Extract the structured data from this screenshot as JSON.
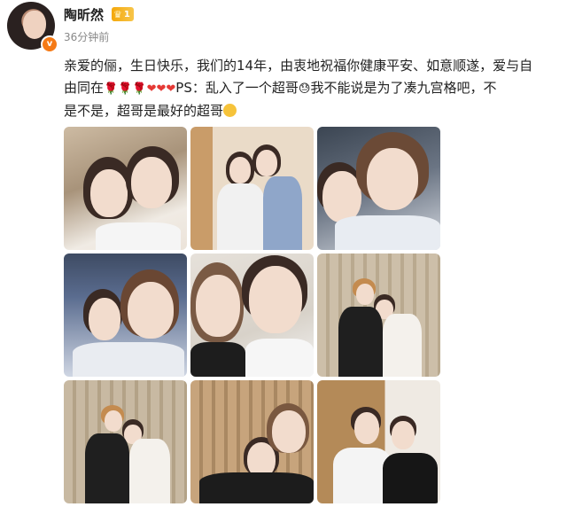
{
  "user": {
    "name": "陶昕然",
    "level": "1",
    "verified_badge": "v",
    "time": "36分钟前"
  },
  "post": {
    "line1": "亲爱的俪，生日快乐，我们的14年，由衷地祝福你健康平安、如意顺遂，爱与自",
    "line2a": "由同在",
    "line2b": "PS：乱入了一个超哥",
    "line2c": "我不能说是为了凑九宫格吧，不",
    "line3": "是不是，超哥是最好的超哥",
    "emoji": {
      "rose": "🌹",
      "heart": "❤",
      "sweat": "😓"
    }
  },
  "photos": [
    {
      "alt": "photo-1"
    },
    {
      "alt": "photo-2"
    },
    {
      "alt": "photo-3"
    },
    {
      "alt": "photo-4"
    },
    {
      "alt": "photo-5"
    },
    {
      "alt": "photo-6"
    },
    {
      "alt": "photo-7"
    },
    {
      "alt": "photo-8"
    },
    {
      "alt": "photo-9"
    }
  ],
  "colors": {
    "level_badge": "#f4a80b",
    "verified": "#f57a16"
  }
}
